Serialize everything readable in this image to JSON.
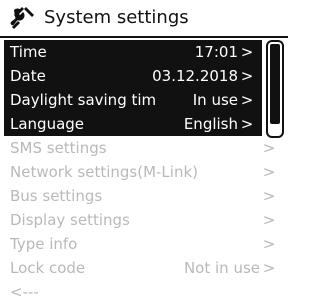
{
  "header": {
    "title": "System settings",
    "icon": "wrench-screwdriver-icon"
  },
  "colors": {
    "foreground": "#111111",
    "highlight_bg": "#111111",
    "highlight_text": "#ffffff",
    "inactive_text": "#b9b9b9",
    "background": "#ffffff"
  },
  "menu": {
    "items": [
      {
        "label": "Time",
        "value": "17:01",
        "chevron": ">"
      },
      {
        "label": "Date",
        "value": "03.12.2018",
        "chevron": ">"
      },
      {
        "label": "Daylight saving tim",
        "value": "In use",
        "chevron": ">"
      },
      {
        "label": "Language",
        "value": "English",
        "chevron": ">"
      },
      {
        "label": "SMS settings",
        "value": "",
        "chevron": ">"
      },
      {
        "label": "Network settings(M-Link)",
        "value": "",
        "chevron": ">"
      },
      {
        "label": "Bus settings",
        "value": "",
        "chevron": ">"
      },
      {
        "label": "Display settings",
        "value": "",
        "chevron": ">"
      },
      {
        "label": "Type info",
        "value": "",
        "chevron": ">"
      },
      {
        "label": "Lock code",
        "value": "Not in use",
        "chevron": ">"
      },
      {
        "label": "<---",
        "value": "",
        "chevron": ""
      }
    ]
  }
}
